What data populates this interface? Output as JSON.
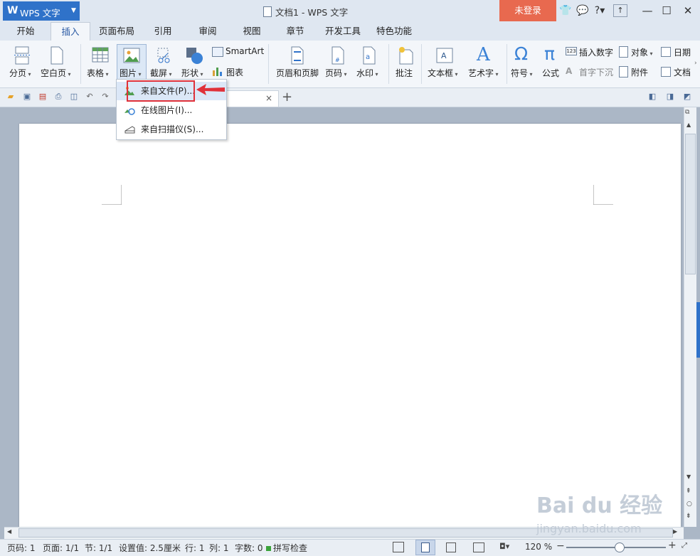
{
  "app": {
    "logo_text": "WPS 文字",
    "window_title": "文档1 - WPS 文字",
    "login": "未登录"
  },
  "tabs": [
    "开始",
    "插入",
    "页面布局",
    "引用",
    "审阅",
    "视图",
    "章节",
    "开发工具",
    "特色功能"
  ],
  "active_tab": "插入",
  "ribbon": {
    "page_break": "分页",
    "blank_page": "空白页",
    "table": "表格",
    "picture": "图片",
    "screenshot": "截屏",
    "shape": "形状",
    "smartart": "SmartArt",
    "chart": "图表",
    "header_footer": "页眉和页脚",
    "page_number": "页码",
    "watermark": "水印",
    "comment": "批注",
    "textbox": "文本框",
    "wordart": "艺术字",
    "symbol": "符号",
    "formula": "公式",
    "insert_number": "插入数字",
    "drop_cap": "首字下沉",
    "object": "对象",
    "attachment": "附件",
    "date": "日期",
    "document": "文档"
  },
  "picture_menu": {
    "items": [
      "来自文件(P)...",
      "在线图片(I)...",
      "来自扫描仪(S)..."
    ],
    "highlighted_index": 0
  },
  "status": {
    "page_num": "页码: 1",
    "pages": "页面: 1/1",
    "section": "节: 1/1",
    "setting": "设置值: 2.5厘米",
    "row": "行: 1",
    "col": "列: 1",
    "word_count": "字数: 0",
    "spell_check": "拼写检查",
    "zoom": "120 %"
  },
  "watermark": {
    "brand": "Bai du 经验",
    "url": "jingyan.baidu.com"
  },
  "colors": {
    "accent_blue": "#2f72c9",
    "login_bg": "#e8694f",
    "highlight_red": "#e0313a"
  }
}
